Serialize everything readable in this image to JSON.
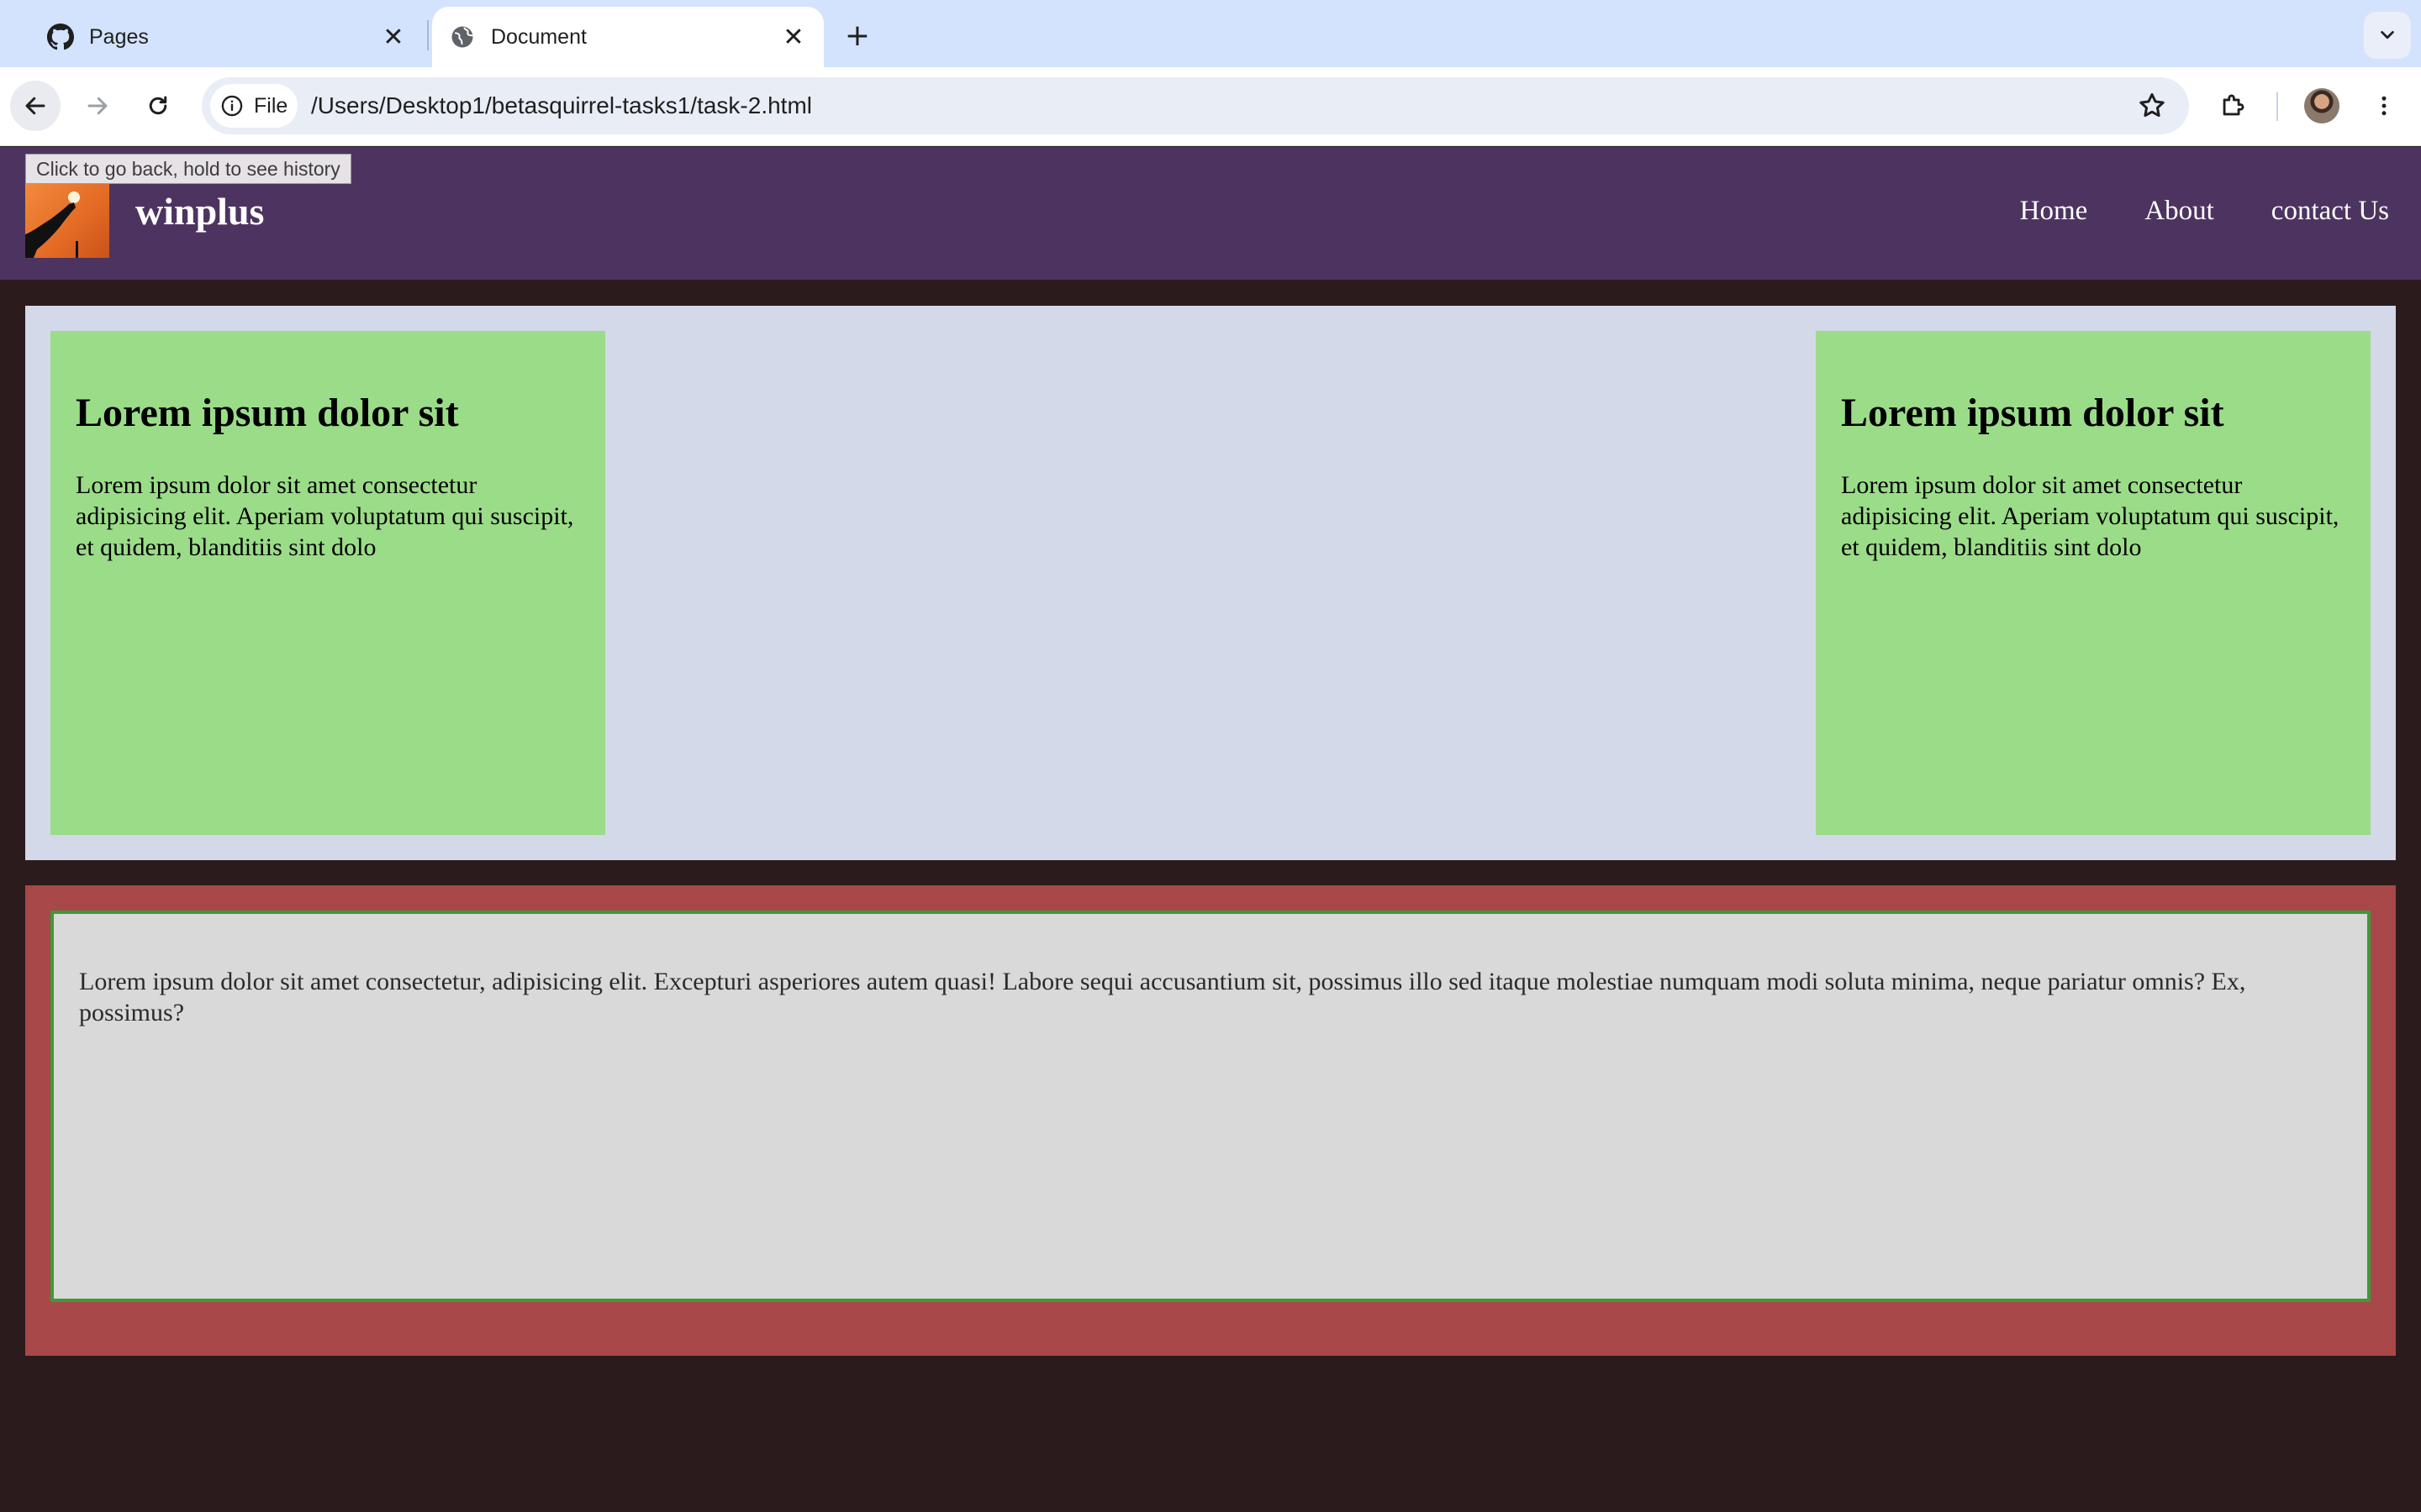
{
  "browser": {
    "tabs": [
      {
        "title": "Pages",
        "icon": "github-icon",
        "active": false
      },
      {
        "title": "Document",
        "icon": "globe-icon",
        "active": true
      }
    ],
    "site_chip": "File",
    "url": "/Users/Desktop1/betasquirrel-tasks1/task-2.html",
    "tooltip": "Click to go back, hold to see history"
  },
  "site": {
    "brand": "winplus",
    "nav": [
      "Home",
      "About",
      "contact Us"
    ],
    "cards": [
      {
        "heading": "Lorem ipsum dolor sit",
        "body": "Lorem ipsum dolor sit amet consectetur adipisicing elit. Aperiam voluptatum qui suscipit, et quidem, blanditiis sint dolo"
      },
      {
        "heading": "Lorem ipsum dolor sit",
        "body": "Lorem ipsum dolor sit amet consectetur adipisicing elit. Aperiam voluptatum qui suscipit, et quidem, blanditiis sint dolo"
      }
    ],
    "footer_text": "Lorem ipsum dolor sit amet consectetur, adipisicing elit. Excepturi asperiores autem quasi! Labore sequi accusantium sit, possimus illo sed itaque molestiae numquam modi soluta minima, neque pariatur omnis? Ex, possimus?"
  },
  "colors": {
    "header": "#4d3460",
    "hero_bg": "#d3d9e8",
    "card": "#9bdc88",
    "lower_bg": "#a84848",
    "text_box": "#d9d9d9",
    "text_box_border": "#3e9a37",
    "page_bg": "#2c1b1d"
  }
}
